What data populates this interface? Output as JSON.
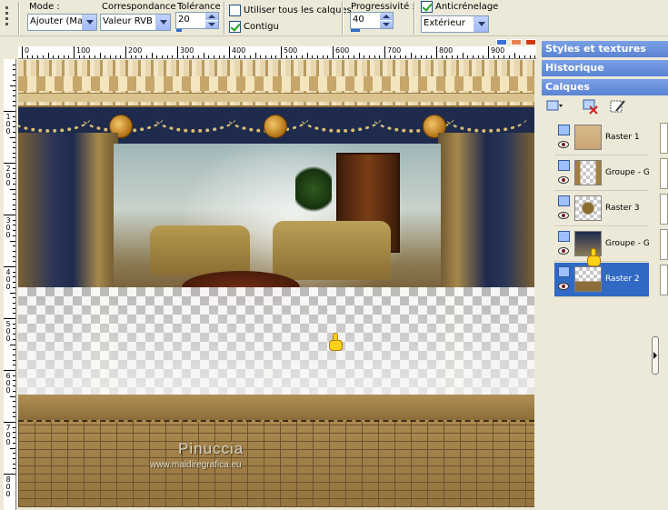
{
  "tool_options": {
    "mode_label": "Mode :",
    "mode_value": "Ajouter (Maœ",
    "match_label": "Correspondance :",
    "match_value": "Valeur RVB",
    "tolerance_label": "Tolérance :",
    "tolerance_value": "20",
    "use_all_layers_label": "Utiliser tous les calques",
    "use_all_layers_checked": false,
    "contiguous_label": "Contigu",
    "contiguous_checked": true,
    "feather_label": "Progressivité :",
    "feather_value": "40",
    "antialias_label": "Anticrénelage",
    "antialias_checked": true,
    "antialias_mode_value": "Extérieur"
  },
  "rulers": {
    "horizontal": [
      "0",
      "100",
      "200",
      "300",
      "400",
      "500",
      "600",
      "700",
      "800",
      "900"
    ],
    "vertical": [
      "1\n0\n0",
      "2\n0\n0",
      "3\n0\n0",
      "4\n0\n0",
      "5\n0\n0",
      "6\n0\n0",
      "7\n0\n0",
      "8\n0\n0"
    ]
  },
  "canvas": {
    "watermark_title": "Pinuccia",
    "watermark_url": "www.maidiregrafica.eu"
  },
  "palettes": {
    "styles_title": "Styles et textures",
    "history_title": "Historique",
    "layers_title": "Calques",
    "layers": [
      {
        "name": "Raster 1",
        "selected": false
      },
      {
        "name": "Groupe - Gr",
        "selected": false
      },
      {
        "name": "Raster 3",
        "selected": false
      },
      {
        "name": "Groupe - Gr",
        "selected": false
      },
      {
        "name": "Raster 2",
        "selected": true
      }
    ]
  },
  "colors": {
    "palette_title_bg": "#5a83d3",
    "selection": "#316ac5",
    "chrome": "#ece9d8"
  }
}
